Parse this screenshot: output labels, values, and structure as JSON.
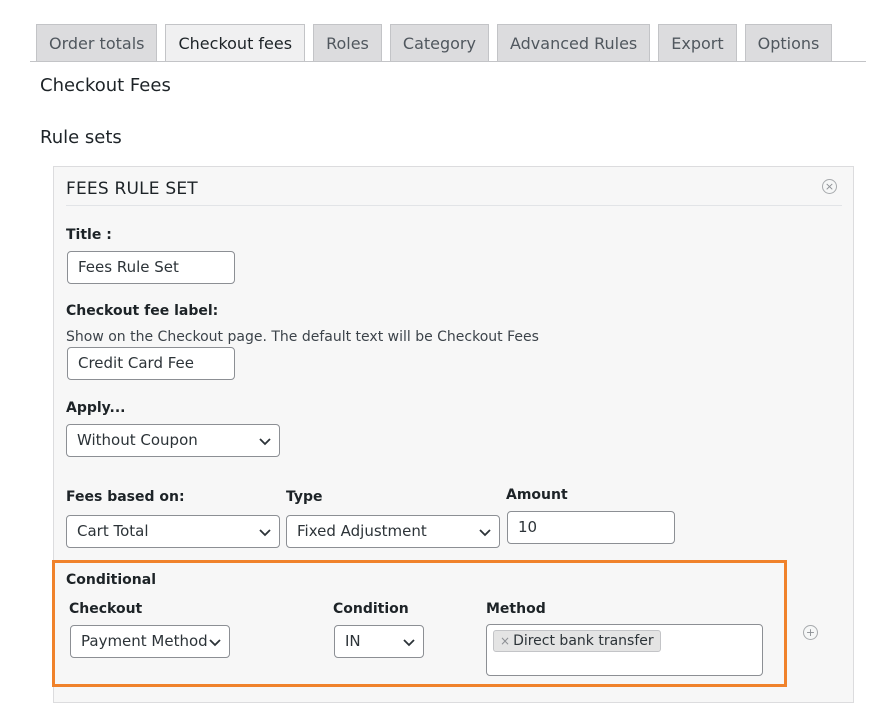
{
  "tabs": [
    {
      "label": "Order totals",
      "active": false
    },
    {
      "label": "Checkout fees",
      "active": true
    },
    {
      "label": "Roles",
      "active": false
    },
    {
      "label": "Category",
      "active": false
    },
    {
      "label": "Advanced Rules",
      "active": false
    },
    {
      "label": "Export",
      "active": false
    },
    {
      "label": "Options",
      "active": false
    }
  ],
  "page": {
    "title": "Checkout Fees",
    "section_title": "Rule sets"
  },
  "rule_set": {
    "header": "FEES RULE SET",
    "title_label": "Title :",
    "title_value": "Fees Rule Set",
    "fee_label_label": "Checkout fee label:",
    "fee_label_help": "Show on the Checkout page. The default text will be Checkout Fees",
    "fee_label_value": "Credit Card Fee",
    "apply_label": "Apply...",
    "apply_value": "Without Coupon",
    "fees_based_label": "Fees based on:",
    "fees_based_value": "Cart Total",
    "type_label": "Type",
    "type_value": "Fixed Adjustment",
    "amount_label": "Amount",
    "amount_value": "10"
  },
  "conditional": {
    "label": "Conditional",
    "checkout_label": "Checkout",
    "checkout_value": "Payment Method",
    "condition_label": "Condition",
    "condition_value": "IN",
    "method_label": "Method",
    "method_chip": "Direct bank transfer"
  },
  "icons": {
    "remove": "close-circle-icon",
    "add": "plus-circle-icon",
    "chevron": "chevron-down-icon"
  },
  "colors": {
    "highlight": "#f0822b",
    "tab_active": "#f0f0f1",
    "tab_inactive": "#dcdcde"
  }
}
